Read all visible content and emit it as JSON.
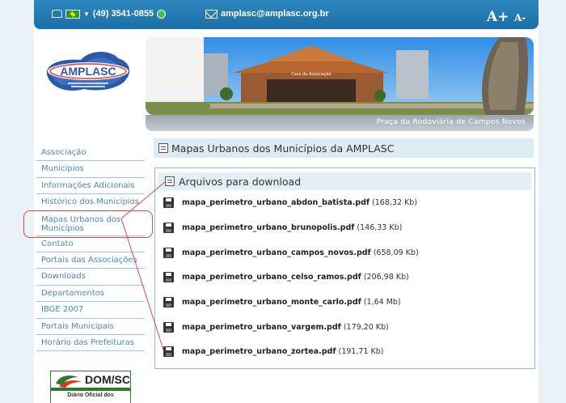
{
  "header": {
    "phone": "(49) 3541-0855",
    "email": "amplasc@amplasc.org.br",
    "font_increase": "A+",
    "font_decrease": "A-"
  },
  "logo": {
    "text": "AMPLASC"
  },
  "banner": {
    "sign_text": "Casa da Associação",
    "caption": "Praça da Rodoviária de Campos Novos"
  },
  "sidebar": {
    "items": [
      {
        "label": "Associação"
      },
      {
        "label": "Municípios"
      },
      {
        "label": "Informações Adicionais"
      },
      {
        "label": "Histórico dos Municípios"
      },
      {
        "label": "Mapas Urbanos dos Municípios"
      },
      {
        "label": "Contato"
      },
      {
        "label": "Portais das Associações"
      },
      {
        "label": "Downloads"
      },
      {
        "label": "Departamentos"
      },
      {
        "label": "IBGE 2007"
      },
      {
        "label": "Portais Municipais"
      },
      {
        "label": "Horário das Prefeituras"
      }
    ]
  },
  "dom_box": {
    "title": "DOM/SC",
    "subtitle": "Diário Oficial dos"
  },
  "main": {
    "title": "Mapas Urbanos dos Municípios da AMPLASC",
    "downloads_title": "Arquivos para download",
    "files": [
      {
        "name": "mapa_perimetro_urbano_abdon_batista.pdf",
        "size": "(168,32 Kb)"
      },
      {
        "name": "mapa_perimetro_urbano_brunopolis.pdf",
        "size": "(146,33 Kb)"
      },
      {
        "name": "mapa_perimetro_urbano_campos_novos.pdf",
        "size": "(658,09 Kb)"
      },
      {
        "name": "mapa_perimetro_urbano_celso_ramos.pdf",
        "size": "(206,98 Kb)"
      },
      {
        "name": "mapa_perimetro_urbano_monte_carlo.pdf",
        "size": "(1,64 Mb)"
      },
      {
        "name": "mapa_perimetro_urbano_vargem.pdf",
        "size": "(179,20 Kb)"
      },
      {
        "name": "mapa_perimetro_urbano_zortea.pdf",
        "size": "(191,71 Kb)"
      }
    ]
  },
  "colors": {
    "header_blue": "#1b6ea5",
    "menu_link": "#4a8ab0",
    "annotation_red": "#d94a4a"
  }
}
